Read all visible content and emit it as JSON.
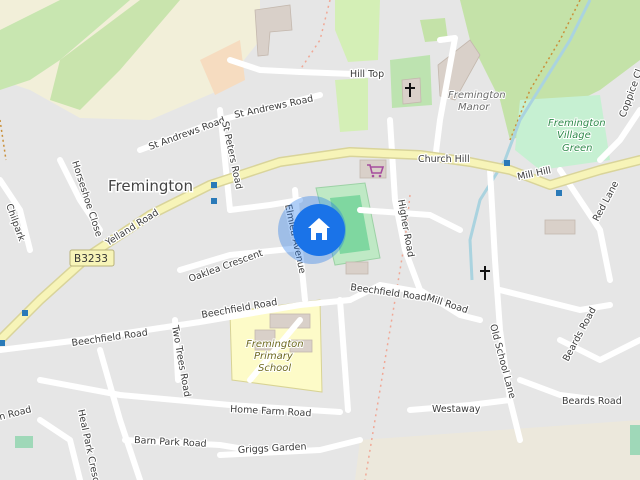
{
  "map": {
    "place_name": "Fremington",
    "road_ref": "B3233",
    "roads": {
      "hill_top": "Hill Top",
      "st_andrews_road_1": "St Andrews Road",
      "st_andrews_road_2": "St Andrews Road",
      "st_peters_road": "St Peters Road",
      "church_hill": "Church Hill",
      "mill_hill": "Mill Hill",
      "horseshoe_close": "Horseshoe Close",
      "yelland_road": "Yelland Road",
      "chilpark": "Chilpark",
      "elmlea_avenue": "Elmlea Avenue",
      "oaklea_crescent": "Oaklea Crescent",
      "higher_road": "Higher Road",
      "beechfield_road_1": "Beechfield Road",
      "beechfield_road_2": "Beechfield Road",
      "beechfield_road_3": "Beechfield Road",
      "mill_road": "Mill Road",
      "two_trees_road": "Two Trees Road",
      "old_school_lane": "Old School Lane",
      "beards_road_1": "Beards Road",
      "beards_road_2": "Beards Road",
      "red_lane": "Red Lane",
      "coppice_close": "Coppice Cl",
      "home_farm_road": "Home Farm Road",
      "westaway": "Westaway",
      "barn_park_road": "Barn Park Road",
      "griggs_garden": "Griggs Garden",
      "heal_park_crescent": "Heal Park Crescent",
      "road_partial": "n Road"
    },
    "pois": {
      "fremington_manor_line1": "Fremington",
      "fremington_manor_line2": "Manor",
      "village_green_line1": "Fremington",
      "village_green_line2": "Village",
      "village_green_line3": "Green",
      "school_line1": "Fremington",
      "school_line2": "Primary",
      "school_line3": "School"
    },
    "icons": [
      "church-icon",
      "shop-cart-icon",
      "home-icon"
    ],
    "colors": {
      "background": "#e6e6e6",
      "main_road": "#f7f4b8",
      "minor_road": "#ffffff",
      "park": "#cdebb0",
      "school": "#fdfbc8",
      "water": "#aad3df",
      "home_marker": "#1a73e8",
      "rail": "#f08a6a"
    }
  }
}
